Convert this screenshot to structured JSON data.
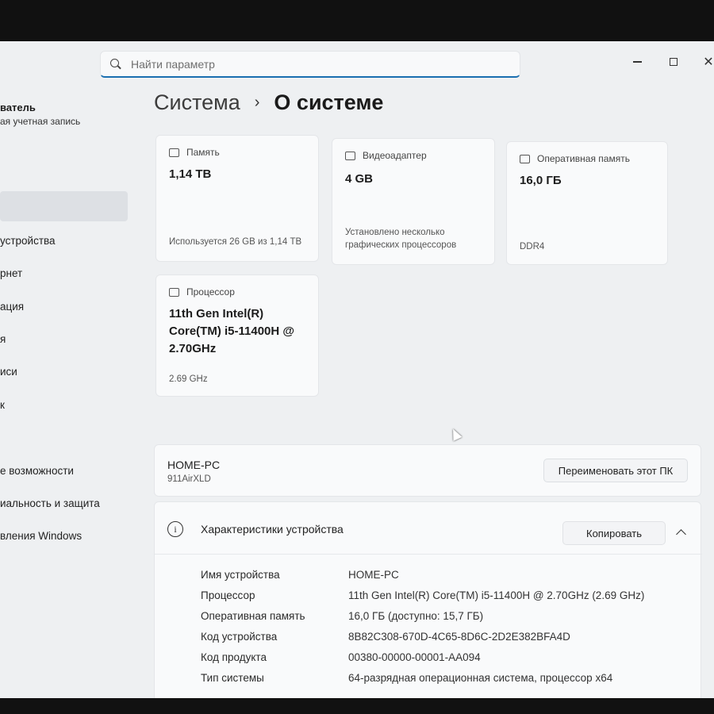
{
  "search": {
    "placeholder": "Найти параметр"
  },
  "window_controls": {
    "close": "✕"
  },
  "sidebar": {
    "user_name": "ватель",
    "user_account": "ая учетная запись",
    "items": [
      {
        "label": "устройства"
      },
      {
        "label": "рнет"
      },
      {
        "label": "ация"
      },
      {
        "label": "я"
      },
      {
        "label": "иси"
      },
      {
        "label": "к"
      },
      {
        "label": "е возможности"
      },
      {
        "label": "иальность и защита"
      },
      {
        "label": "вления Windows"
      }
    ]
  },
  "breadcrumb": {
    "parent": "Система",
    "separator": "›",
    "current": "О системе"
  },
  "cards": {
    "storage": {
      "title": "Память",
      "value": "1,14 TB",
      "sub": "Используется 26 GB из 1,14 TB"
    },
    "gpu": {
      "title": "Видеоадаптер",
      "value": "4 GB",
      "sub": "Установлено несколько графических процессоров"
    },
    "ram": {
      "title": "Оперативная память",
      "value": "16,0 ГБ",
      "sub": "DDR4"
    },
    "cpu": {
      "title": "Процессор",
      "value": "11th Gen Intel(R) Core(TM) i5-11400H @ 2.70GHz",
      "sub": "2.69 GHz"
    }
  },
  "pc": {
    "name": "HOME-PC",
    "model": "911AirXLD",
    "rename_label": "Переименовать этот ПК"
  },
  "specs": {
    "title": "Характеристики устройства",
    "info_glyph": "i",
    "copy_label": "Копировать",
    "rows": [
      {
        "label": "Имя устройства",
        "value": "HOME-PC"
      },
      {
        "label": "Процессор",
        "value": "11th Gen Intel(R) Core(TM) i5-11400H @ 2.70GHz (2.69 GHz)"
      },
      {
        "label": "Оперативная память",
        "value": "16,0 ГБ (доступно: 15,7 ГБ)"
      },
      {
        "label": "Код устройства",
        "value": "8B82C308-670D-4C65-8D6C-2D2E382BFA4D"
      },
      {
        "label": "Код продукта",
        "value": "00380-00000-00001-AA094"
      },
      {
        "label": "Тип системы",
        "value": "64-разрядная операционная система, процессор x64"
      }
    ]
  }
}
